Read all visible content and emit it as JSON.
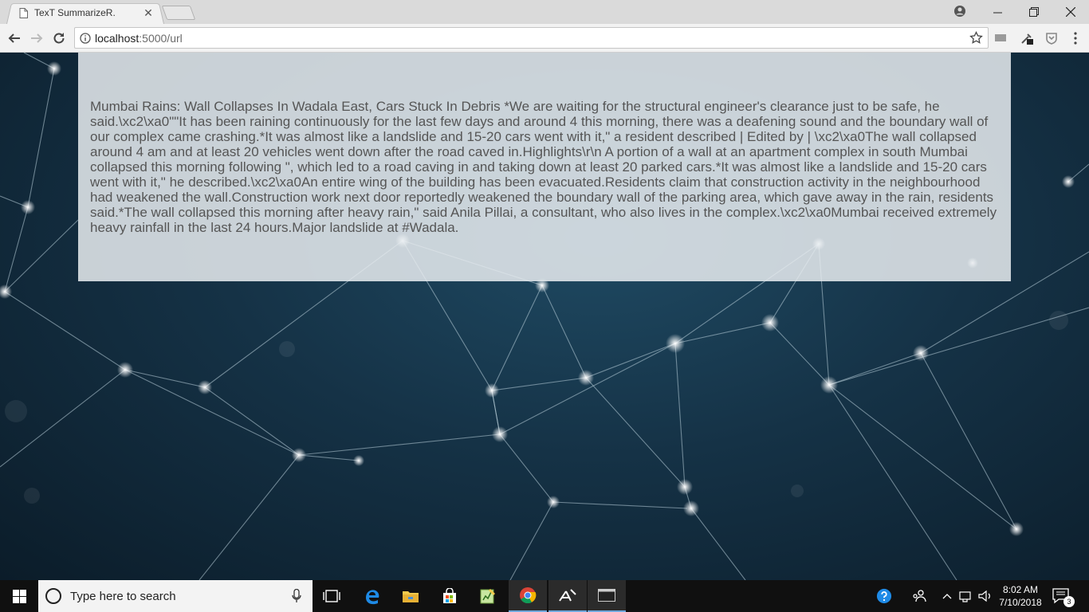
{
  "browser": {
    "tab_title": "TexT SummarizeR.",
    "url_host": "localhost",
    "url_rest": ":5000/url"
  },
  "page": {
    "summary": "Mumbai Rains: Wall Collapses In Wadala East, Cars Stuck In Debris *We are waiting for the structural engineer's clearance just to be safe, he said.\\xc2\\xa0\"\"It has been raining continuously for the last few days and around 4 this morning, there was a deafening sound and the boundary wall of our complex came crashing.*It was almost like a landslide and 15-20 cars went with it,\" a resident described | Edited by | \\xc2\\xa0The wall collapsed around 4 am and at least 20 vehicles went down after the road caved in.Highlights\\r\\n A portion of a wall at an apartment complex in south Mumbai collapsed this morning following \", which led to a road caving in and taking down at least 20 parked cars.*It was almost like a landslide and 15-20 cars went with it,\" he described.\\xc2\\xa0An entire wing of the building has been evacuated.Residents claim that construction activity in the neighbourhood had weakened the wall.Construction work next door reportedly weakened the boundary wall of the parking area, which gave away in the rain, residents said.*The wall collapsed this morning after heavy rain,\" said Anila Pillai, a consultant, who also lives in the complex.\\xc2\\xa0Mumbai received extremely heavy rainfall in the last 24 hours.Major landslide at #Wadala."
  },
  "taskbar": {
    "search_placeholder": "Type here to search",
    "time": "8:02 AM",
    "date": "7/10/2018",
    "notification_count": "3"
  },
  "colors": {
    "chrome_toolbar": "#f2f2f2",
    "taskbar": "#101010",
    "summary_text": "#555555"
  }
}
